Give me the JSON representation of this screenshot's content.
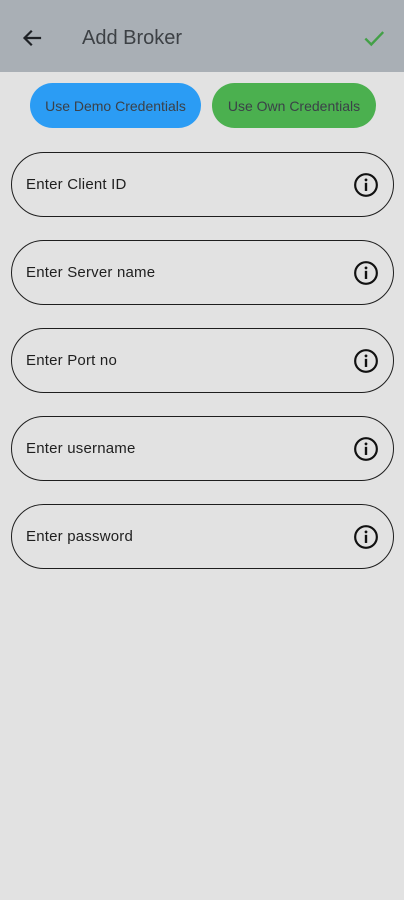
{
  "header": {
    "title": "Add Broker",
    "back_icon": "arrow-left-icon",
    "confirm_icon": "check-icon",
    "confirm_color": "#43a047",
    "background": "#a9afb5"
  },
  "actions": {
    "demo_label": "Use Demo Credentials",
    "own_label": "Use Own Credentials",
    "demo_color": "#2b9cf4",
    "own_color": "#4bb04f"
  },
  "fields": [
    {
      "placeholder": "Enter Client ID",
      "icon": "info-icon"
    },
    {
      "placeholder": "Enter Server name",
      "icon": "info-icon"
    },
    {
      "placeholder": "Enter Port no",
      "icon": "info-icon"
    },
    {
      "placeholder": "Enter username",
      "icon": "info-icon"
    },
    {
      "placeholder": "Enter password",
      "icon": "info-icon"
    }
  ]
}
